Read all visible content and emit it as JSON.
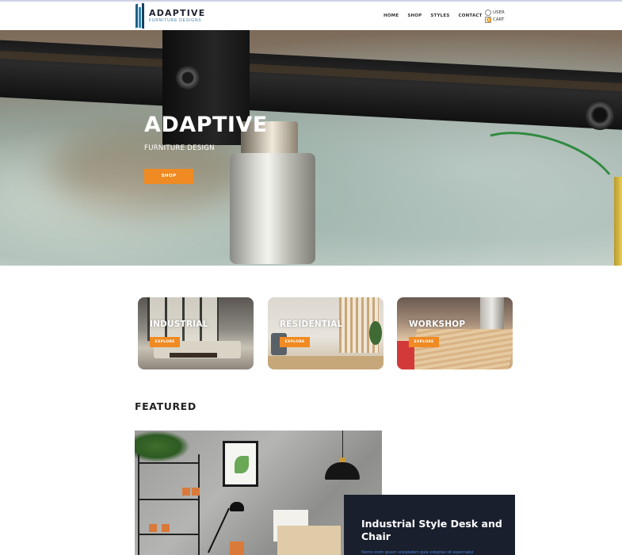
{
  "header": {
    "logo_title": "ADAPTIVE",
    "logo_subtitle": "FURNITURE DESIGNS",
    "nav": [
      "HOME",
      "SHOP",
      "STYLES",
      "CONTACT"
    ],
    "user_label": "USER",
    "cart_label": "CART",
    "cart_count": "0"
  },
  "hero": {
    "title": "ADAPTIVE",
    "subtitle": "FURNITURE DESIGN",
    "button": "SHOP"
  },
  "categories": [
    {
      "title": "INDUSTRIAL",
      "button": "EXPLORE"
    },
    {
      "title": "RESIDENTIAL",
      "button": "EXPLORE"
    },
    {
      "title": "WORKSHOP",
      "button": "EXPLORE"
    }
  ],
  "featured": {
    "heading": "FEATURED",
    "item_title": "Industrial Style Desk and Chair",
    "item_desc": "Nemo enim ipsam voluptatem quia voluptas sit aspernatur"
  },
  "colors": {
    "accent": "#f08a22",
    "panel": "#1a1f2d",
    "logo_blue": "#1f5f86"
  }
}
